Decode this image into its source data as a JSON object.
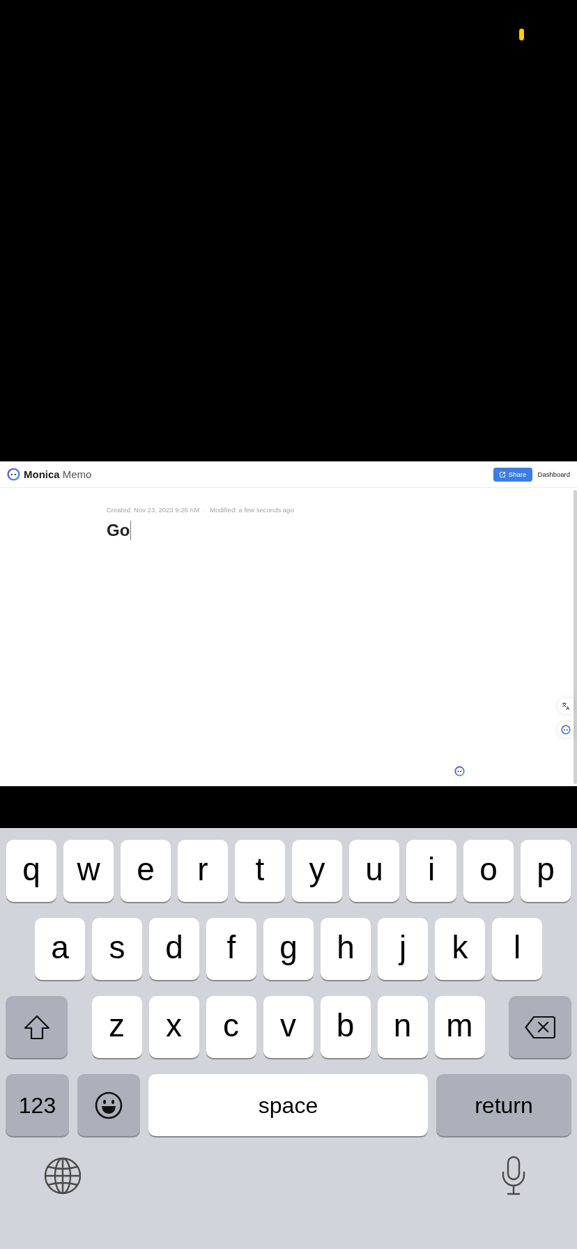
{
  "header": {
    "brand": "Monica",
    "product": "Memo",
    "share_button": "Share",
    "dashboard_link": "Dashboard"
  },
  "memo": {
    "created": "Created: Nov 23, 2023 9:26 AM",
    "separator": "·",
    "modified": "Modified: a few seconds ago",
    "title": "Go"
  },
  "keyboard": {
    "rows": [
      {
        "keys": [
          {
            "kind": "letter",
            "label": "q"
          },
          {
            "kind": "letter",
            "label": "w"
          },
          {
            "kind": "letter",
            "label": "e"
          },
          {
            "kind": "letter",
            "label": "r"
          },
          {
            "kind": "letter",
            "label": "t"
          },
          {
            "kind": "letter",
            "label": "y"
          },
          {
            "kind": "letter",
            "label": "u"
          },
          {
            "kind": "letter",
            "label": "i"
          },
          {
            "kind": "letter",
            "label": "o"
          },
          {
            "kind": "letter",
            "label": "p"
          }
        ]
      },
      {
        "keys": [
          {
            "kind": "letter",
            "label": "a"
          },
          {
            "kind": "letter",
            "label": "s"
          },
          {
            "kind": "letter",
            "label": "d"
          },
          {
            "kind": "letter",
            "label": "f"
          },
          {
            "kind": "letter",
            "label": "g"
          },
          {
            "kind": "letter",
            "label": "h"
          },
          {
            "kind": "letter",
            "label": "j"
          },
          {
            "kind": "letter",
            "label": "k"
          },
          {
            "kind": "letter",
            "label": "l"
          }
        ]
      },
      {
        "keys": [
          {
            "kind": "shift"
          },
          {
            "kind": "letter",
            "label": "z"
          },
          {
            "kind": "letter",
            "label": "x"
          },
          {
            "kind": "letter",
            "label": "c"
          },
          {
            "kind": "letter",
            "label": "v"
          },
          {
            "kind": "letter",
            "label": "b"
          },
          {
            "kind": "letter",
            "label": "n"
          },
          {
            "kind": "letter",
            "label": "m"
          },
          {
            "kind": "delete"
          }
        ]
      },
      {
        "keys": [
          {
            "kind": "mode",
            "label": "123"
          },
          {
            "kind": "emoji"
          },
          {
            "kind": "space",
            "label": "space"
          },
          {
            "kind": "return",
            "label": "return"
          }
        ]
      }
    ]
  }
}
